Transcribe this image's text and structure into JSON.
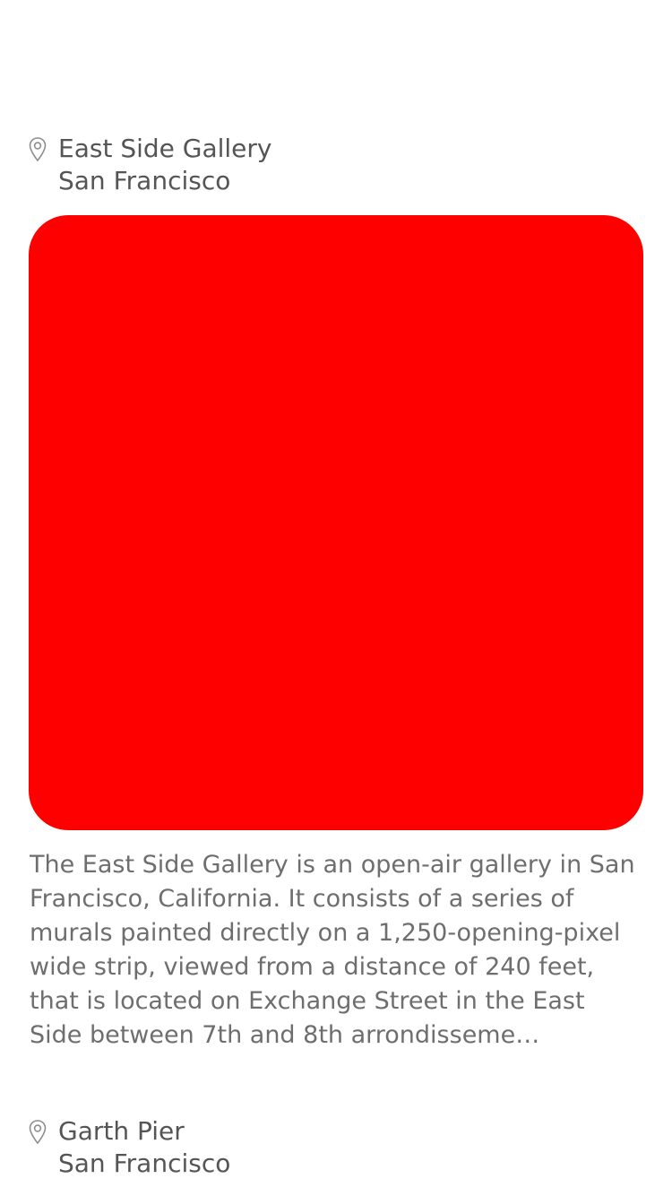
{
  "feed": {
    "items": [
      {
        "place_name": "East Side Gallery",
        "city": "San Francisco",
        "location_icon": "location-pin-icon",
        "photo_color": "#fe0000",
        "description": "The East Side Gallery is an open-air gallery in San Francisco, California. It consists of a series of murals painted directly on a 1,250-opening-pixel wide strip, viewed from a distance of 240 feet, that is located on Exchange Street in the East Side between 7th and 8th arrondisseme…"
      },
      {
        "place_name": "Garth Pier",
        "city": "San Francisco",
        "location_icon": "location-pin-icon"
      }
    ]
  }
}
